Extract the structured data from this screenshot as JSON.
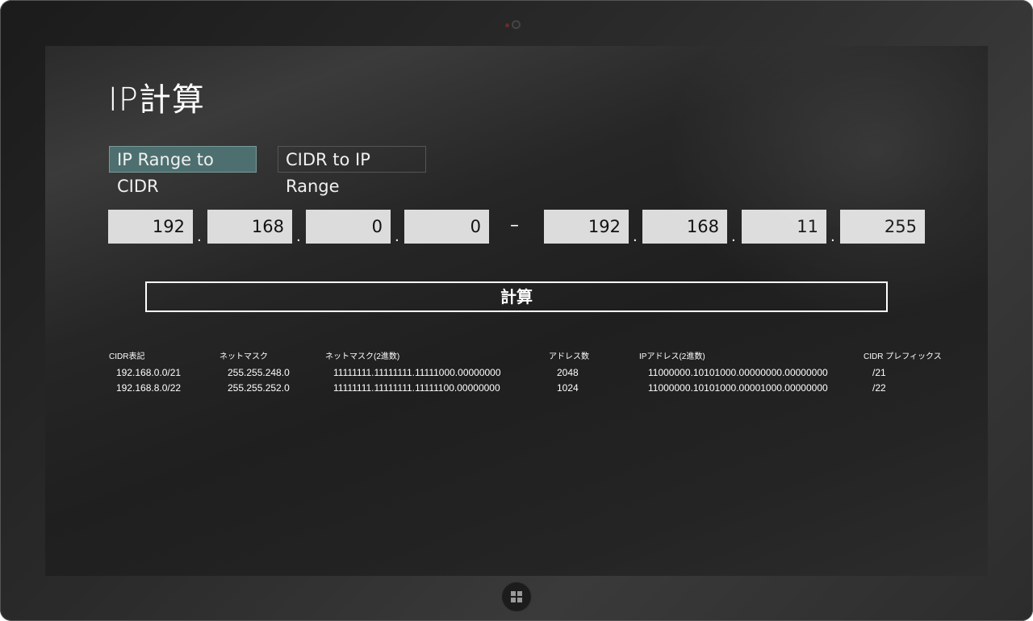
{
  "app": {
    "title": "IP計算"
  },
  "tabs": [
    {
      "label": "IP Range to CIDR",
      "active": true
    },
    {
      "label": "CIDR to IP Range",
      "active": false
    }
  ],
  "range": {
    "start": [
      "192",
      "168",
      "0",
      "0"
    ],
    "end": [
      "192",
      "168",
      "11",
      "255"
    ],
    "separator": ".",
    "dash": "–"
  },
  "calc_button": {
    "label": "計算"
  },
  "table": {
    "headers": [
      "CIDR表記",
      "ネットマスク",
      "ネットマスク(2進数)",
      "アドレス数",
      "IPアドレス(2進数)",
      "CIDR プレフィックス"
    ],
    "rows": [
      [
        "192.168.0.0/21",
        "255.255.248.0",
        "11111111.11111111.11111000.00000000",
        "2048",
        "11000000.10101000.00000000.00000000",
        "/21"
      ],
      [
        "192.168.8.0/22",
        "255.255.252.0",
        "11111111.11111111.11111100.00000000",
        "1024",
        "11000000.10101000.00001000.00000000",
        "/22"
      ]
    ]
  },
  "colors": {
    "accent_tab": "#4d6f6f",
    "input_bg": "#dcdcdc",
    "screen_bg": "#222222"
  },
  "icons": {
    "home": "windows-logo-icon",
    "camera": "camera-icon"
  }
}
